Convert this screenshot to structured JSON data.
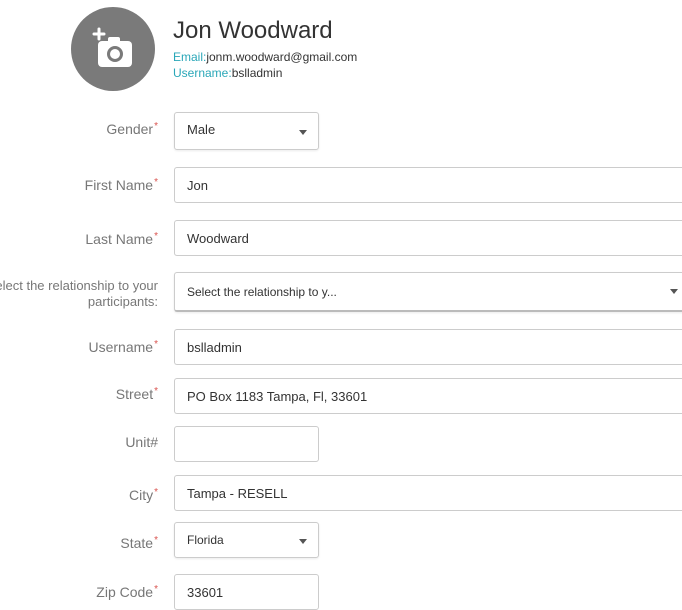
{
  "profile": {
    "name": "Jon Woodward",
    "email_label": "Email:",
    "email": "jonm.woodward@gmail.com",
    "username_label": "Username:",
    "username": "bslladmin",
    "avatar_icon": "add-photo-icon"
  },
  "form": {
    "gender": {
      "label": "Gender",
      "required": "*",
      "value": "Male"
    },
    "first_name": {
      "label": "First Name",
      "required": "*",
      "value": "Jon"
    },
    "last_name": {
      "label": "Last Name",
      "required": "*",
      "value": "Woodward"
    },
    "relationship": {
      "label": "Select the relationship to your participants:",
      "value": "Select the relationship to y..."
    },
    "username": {
      "label": "Username",
      "required": "*",
      "value": "bslladmin"
    },
    "street": {
      "label": "Street",
      "required": "*",
      "value": "PO Box 1183 Tampa, Fl, 33601"
    },
    "unit": {
      "label": "Unit#",
      "value": ""
    },
    "city": {
      "label": "City",
      "required": "*",
      "value": "Tampa - RESELL"
    },
    "state": {
      "label": "State",
      "required": "*",
      "value": "Florida"
    },
    "zip": {
      "label": "Zip Code",
      "required": "*",
      "value": "33601"
    }
  },
  "colors": {
    "accent": "#2aa7b8",
    "required": "#d9534f",
    "avatar_bg": "#7a7a7a"
  }
}
